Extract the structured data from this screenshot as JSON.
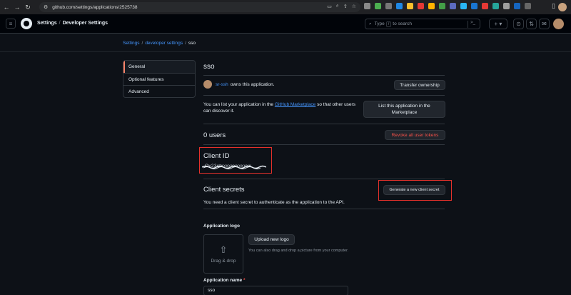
{
  "browser": {
    "url": "github.com/settings/applications/2525738"
  },
  "header": {
    "crumb_settings": "Settings",
    "crumb_sep": "/",
    "crumb_developer": "Developer Settings",
    "search_prefix": "Type",
    "search_key": "/",
    "search_suffix": "to search",
    "plus": "+"
  },
  "breadcrumb": {
    "settings": "Settings",
    "developer": "developer settings",
    "current": "sso",
    "sep": "/"
  },
  "sidebar": {
    "items": [
      {
        "label": "General"
      },
      {
        "label": "Optional features"
      },
      {
        "label": "Advanced"
      }
    ]
  },
  "app": {
    "title": "sso",
    "owner_name": "sr-ssh",
    "owner_suffix": "owns this application.",
    "transfer_button": "Transfer ownership",
    "marketplace_prefix": "You can list your application in the",
    "marketplace_link": "GitHub Marketplace",
    "marketplace_suffix": "so that other users can discover it.",
    "list_button": "List this application in the Marketplace",
    "users_title": "0 users",
    "revoke_button": "Revoke all user tokens",
    "client_id_title": "Client ID",
    "client_id_value": "Ov23ctxxxxxxxxxxxx",
    "secrets_title": "Client secrets",
    "generate_button": "Generate a new client secret",
    "secrets_text": "You need a client secret to authenticate as the application to the API.",
    "logo_label": "Application logo",
    "upload_button": "Upload new logo",
    "dropzone_text": "Drag & drop",
    "drag_hint": "You can also drag and drop a picture from your computer.",
    "name_label": "Application name",
    "name_required": "*",
    "name_value": "sso"
  },
  "colors": {
    "bg": "#0d1117",
    "accent": "#4493f8",
    "danger": "#f85149",
    "annotation": "#e5312b"
  }
}
